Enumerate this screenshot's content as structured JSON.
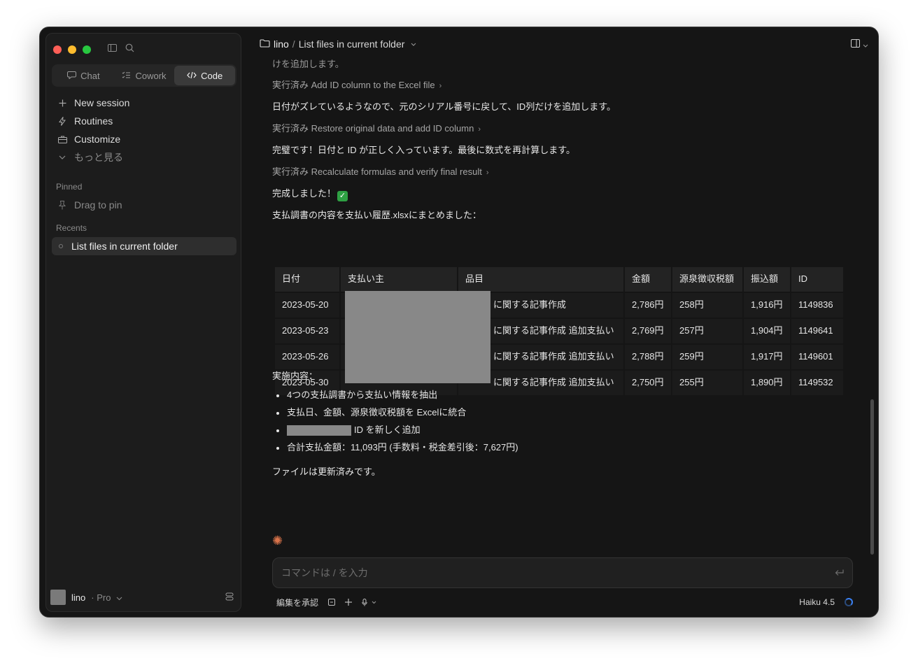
{
  "sidebar": {
    "modes": [
      {
        "label": "Chat",
        "icon": "chat-bubble-icon",
        "active": false
      },
      {
        "label": "Cowork",
        "icon": "checklist-icon",
        "active": false
      },
      {
        "label": "Code",
        "icon": "code-icon",
        "active": true
      }
    ],
    "nav": [
      {
        "label": "New session",
        "icon": "plus-icon"
      },
      {
        "label": "Routines",
        "icon": "bolt-icon"
      },
      {
        "label": "Customize",
        "icon": "briefcase-icon"
      },
      {
        "label": "もっと見る",
        "icon": "chevron-down-icon"
      }
    ],
    "pinned_label": "Pinned",
    "pinned_placeholder": "Drag to pin",
    "recents_label": "Recents",
    "recent_item": "List files in current folder",
    "footer": {
      "name": "lino",
      "plan": "· Pro"
    }
  },
  "header": {
    "folder": "lino",
    "separator": "/",
    "title": "List files in current folder"
  },
  "conversation": {
    "line0": "けを追加します。",
    "step1": "実行済み Add ID column to the Excel file",
    "msg1": "日付がズレているようなので、元のシリアル番号に戻して、ID列だけを追加します。",
    "step2": "実行済み Restore original data and add ID column",
    "msg2": "完璧です！日付と ID が正しく入っています。最後に数式を再計算します。",
    "step3": "実行済み Recalculate formulas and verify final result",
    "msg3": "完成しました！",
    "msg4": "支払調書の内容を支払い履歴.xlsxにまとめました：",
    "table": {
      "headers": [
        "日付",
        "支払い主",
        "品目",
        "金額",
        "源泉徴収税額",
        "振込額",
        "ID"
      ],
      "rows": [
        [
          "2023-05-20",
          "",
          "に関する記事作成",
          "2,786円",
          "258円",
          "1,916円",
          "1149836"
        ],
        [
          "2023-05-23",
          "",
          "に関する記事作成 追加支払い",
          "2,769円",
          "257円",
          "1,904円",
          "1149641"
        ],
        [
          "2023-05-26",
          "",
          "に関する記事作成 追加支払い",
          "2,788円",
          "259円",
          "1,917円",
          "1149601"
        ],
        [
          "2023-05-30",
          "",
          "に関する記事作成 追加支払い",
          "2,750円",
          "255円",
          "1,890円",
          "1149532"
        ]
      ]
    },
    "summary_label": "実施内容：",
    "bullets": [
      "4つの支払調書から支払い情報を抽出",
      "支払日、金額、源泉徴収税額を Excelに統合",
      "ID を新しく追加",
      "合計支払金額：11,093円 (手数料・税金差引後：7,627円)"
    ],
    "final": "ファイルは更新済みです。"
  },
  "composer": {
    "placeholder": "コマンドは / を入力",
    "accept_edits": "編集を承認",
    "model": "Haiku 4.5"
  },
  "colors": {
    "accent_spark": "#d9734a",
    "check_green": "#2ea043",
    "spinner_blue": "#3b82f6"
  }
}
